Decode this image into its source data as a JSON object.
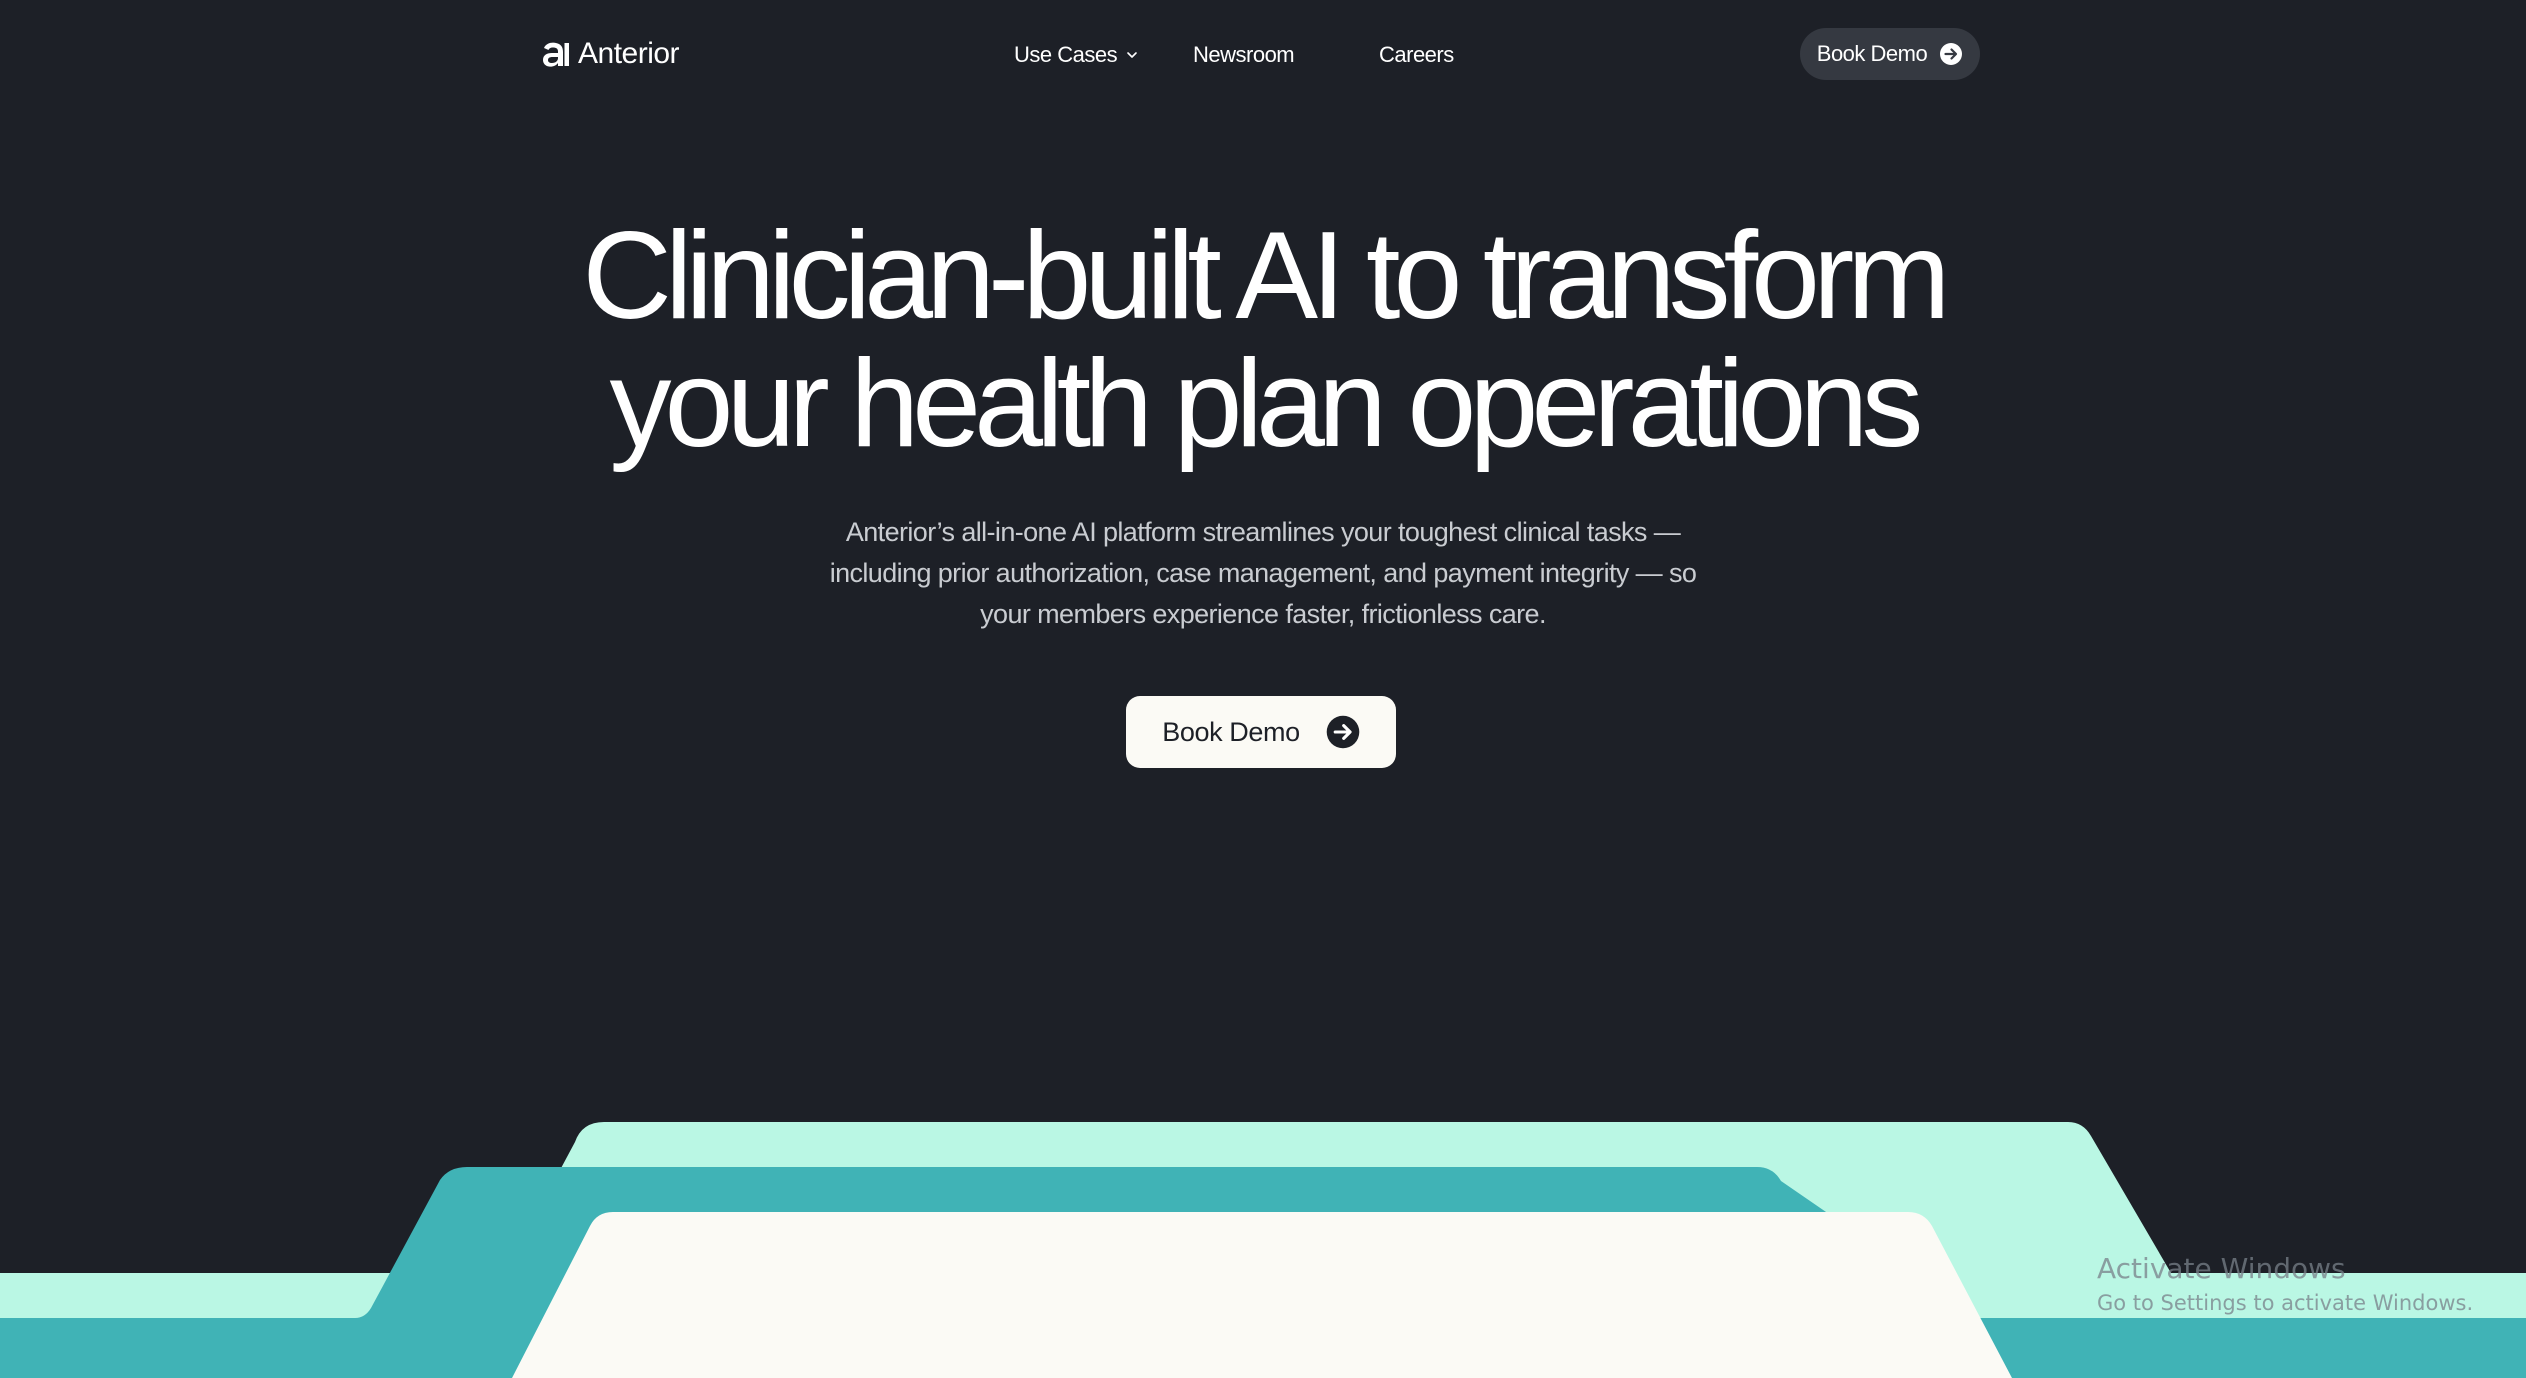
{
  "brand": {
    "name": "Anterior",
    "logo_icon": "anterior-a-logo-icon"
  },
  "nav": {
    "items": [
      {
        "label": "Use Cases",
        "icon": "chevron-down-icon"
      },
      {
        "label": "Newsroom"
      },
      {
        "label": "Careers"
      }
    ],
    "cta_label": "Book Demo",
    "cta_icon": "arrow-right-circle-icon"
  },
  "hero": {
    "title_line_1": "Clinician-built AI to transform",
    "title_line_2": "your health plan operations",
    "subtitle": "Anterior’s all-in-one AI platform streamlines your toughest clinical tasks — including prior authorization, case management, and payment integrity — so your members experience faster, frictionless care.",
    "cta_label": "Book Demo",
    "cta_icon": "arrow-right-circle-icon"
  },
  "watermark": {
    "line_1": "Activate Windows",
    "line_2": "Go to Settings to activate Windows."
  },
  "colors": {
    "background": "#1d2027",
    "mint": "#baf7e4",
    "teal": "#40b3b6",
    "cream": "#fbfaf5",
    "nav_pill": "#353941",
    "subtitle_text": "#c9ccd1"
  }
}
